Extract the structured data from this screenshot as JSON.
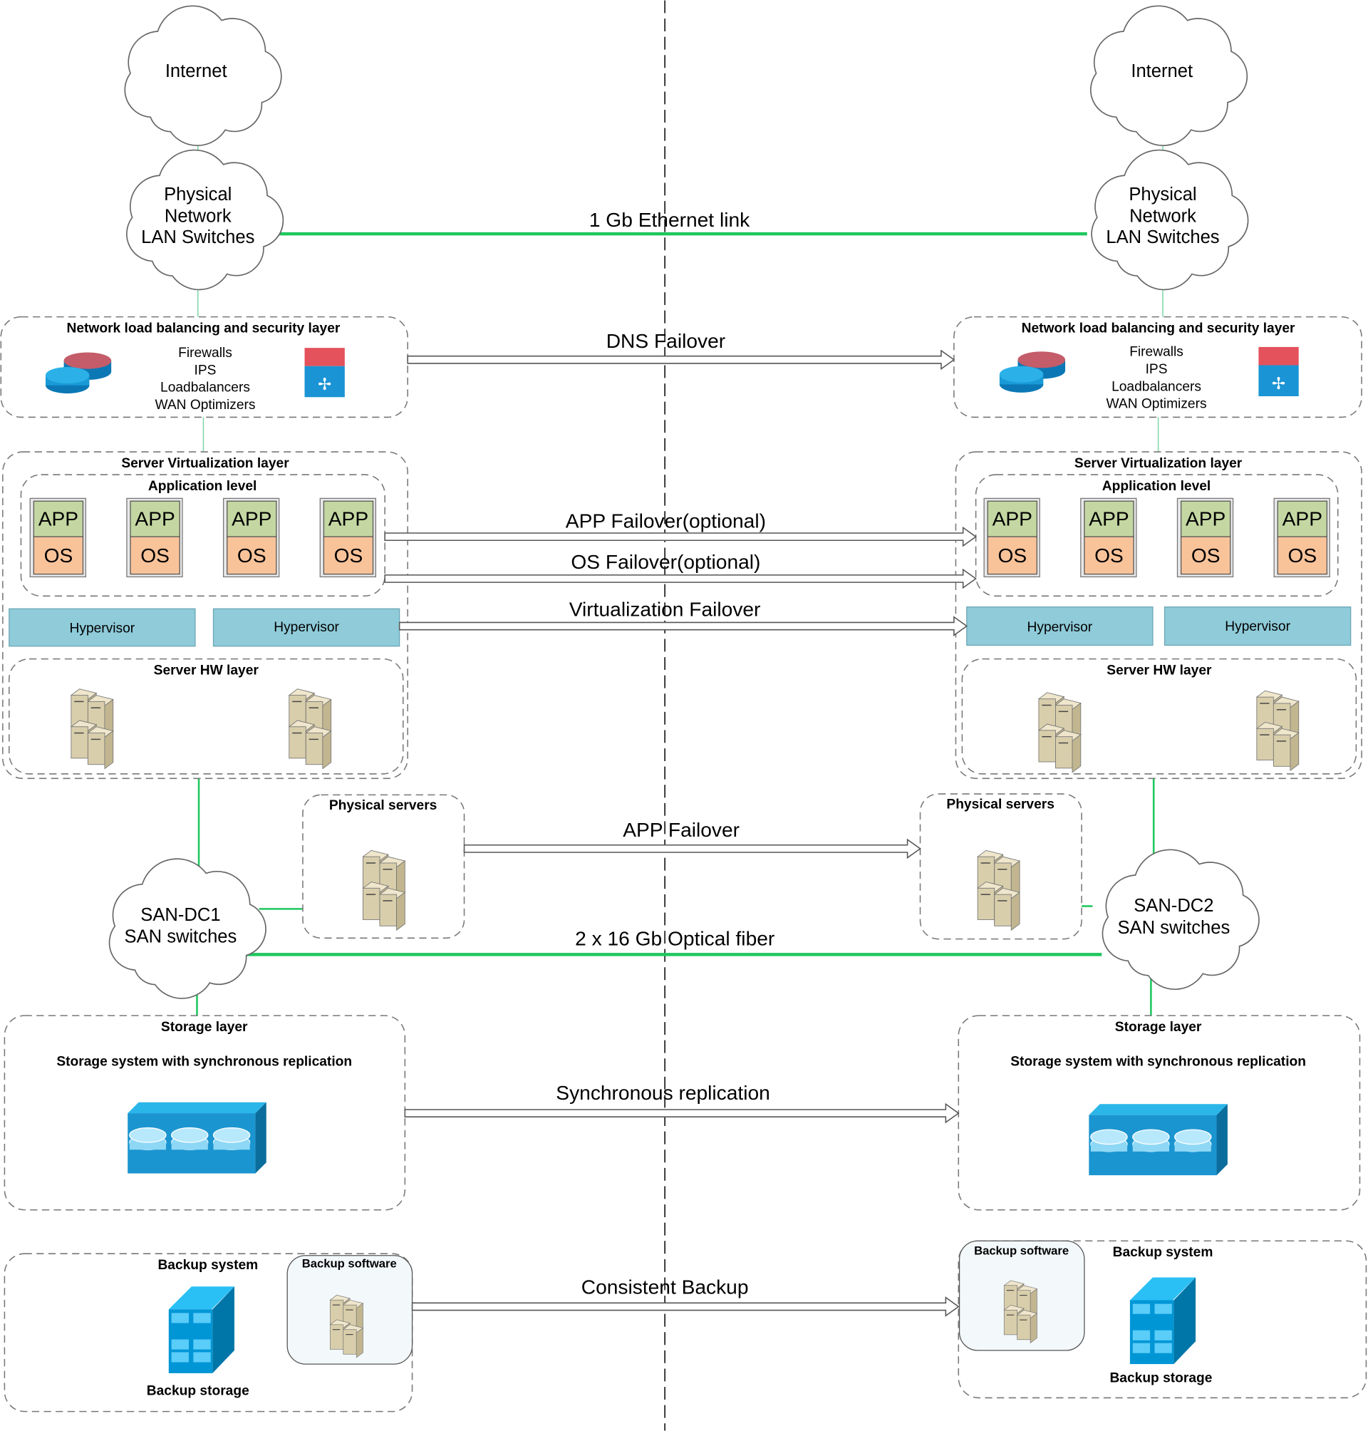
{
  "colors": {
    "link_green": "#1dc75e",
    "app": "#c4d7a2",
    "os": "#f9c39a",
    "hypervisor": "#8fcbd9",
    "storage_blue": "#1b95d0"
  },
  "left": {
    "internet": "Internet",
    "physical_network": [
      "Physical",
      "Network",
      "LAN Switches"
    ],
    "nlb": {
      "title": "Network load balancing and security layer",
      "items": [
        "Firewalls",
        "IPS",
        "Loadbalancers",
        "WAN Optimizers"
      ]
    },
    "virtualization": {
      "title": "Server Virtualization layer",
      "app_level": "Application level",
      "app": "APP",
      "os": "OS",
      "hypervisors": [
        "Hypervisor",
        "Hypervisor"
      ],
      "hw_title": "Server HW layer"
    },
    "physical_servers": "Physical servers",
    "san": [
      "SAN-DC1",
      "SAN switches"
    ],
    "storage": {
      "title": "Storage layer",
      "subtitle": "Storage system with synchronous replication"
    },
    "backup": {
      "title": "Backup system",
      "software": "Backup software",
      "storage": "Backup storage"
    }
  },
  "right": {
    "internet": "Internet",
    "physical_network": [
      "Physical",
      "Network",
      "LAN Switches"
    ],
    "nlb": {
      "title": "Network load balancing and security layer",
      "items": [
        "Firewalls",
        "IPS",
        "Loadbalancers",
        "WAN Optimizers"
      ]
    },
    "virtualization": {
      "title": "Server Virtualization layer",
      "app_level": "Application level",
      "app": "APP",
      "os": "OS",
      "hypervisors": [
        "Hypervisor",
        "Hypervisor"
      ],
      "hw_title": "Server HW layer"
    },
    "physical_servers": "Physical servers",
    "san": [
      "SAN-DC2",
      "SAN switches"
    ],
    "storage": {
      "title": "Storage layer",
      "subtitle": "Storage system with synchronous replication"
    },
    "backup": {
      "title": "Backup system",
      "software": "Backup software",
      "storage": "Backup storage"
    }
  },
  "links": {
    "ethernet": "1 Gb Ethernet link",
    "dns": "DNS Failover",
    "app_failover_optional": "APP Failover(optional)",
    "os_failover_optional": "OS Failover(optional)",
    "virtualization_failover": "Virtualization Failover",
    "app_failover": "APP Failover",
    "fiber": "2 x 16 Gb Optical fiber",
    "sync": "Synchronous replication",
    "backup": "Consistent Backup"
  }
}
